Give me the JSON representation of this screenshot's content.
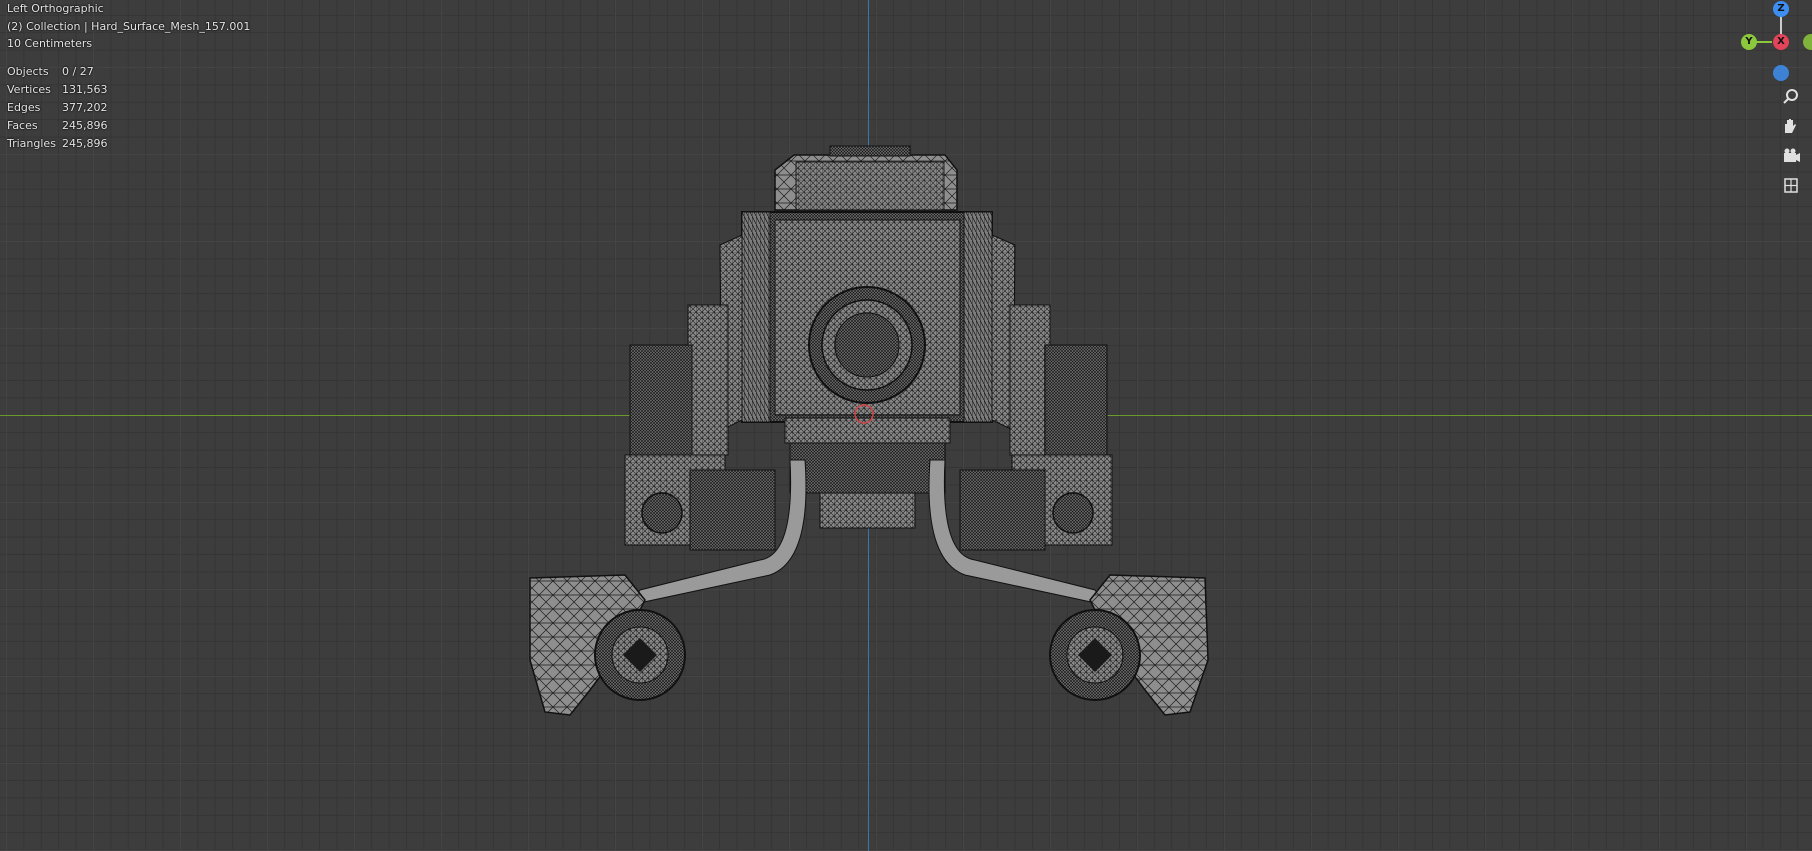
{
  "viewport": {
    "view_name": "Left Orthographic",
    "collection_line": "(2) Collection | Hard_Surface_Mesh_157.001",
    "grid_scale": "10 Centimeters"
  },
  "stats": {
    "rows": [
      {
        "label": "Objects",
        "value": "0 / 27"
      },
      {
        "label": "Vertices",
        "value": "131,563"
      },
      {
        "label": "Edges",
        "value": "377,202"
      },
      {
        "label": "Faces",
        "value": "245,896"
      },
      {
        "label": "Triangles",
        "value": "245,896"
      }
    ]
  },
  "gizmo": {
    "z_label": "Z",
    "y_label": "Y",
    "x_label": "X",
    "x_color": "#e2445a",
    "y_color": "#8cc83c",
    "z_color": "#3d8ef0"
  },
  "nav_tools": [
    "zoom-icon",
    "hand-pan-icon",
    "camera-icon",
    "grid-toggle-icon"
  ],
  "colors": {
    "background": "#3d3d3d",
    "x_axis_line": "#6a9a2c",
    "z_axis_line": "#3f74a8",
    "mesh_fill": "#7a7a7a",
    "wire": "#111111"
  }
}
